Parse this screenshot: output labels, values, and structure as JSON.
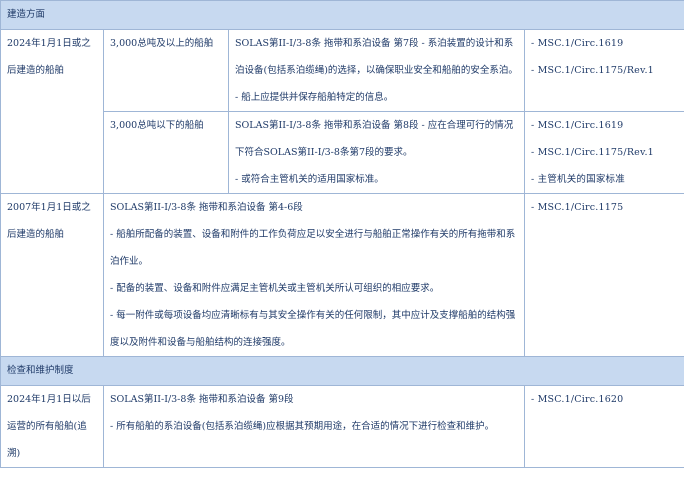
{
  "sections": [
    {
      "title": "建造方面",
      "rows": [
        {
          "scope": "2024年1月1日或之后建造的船舶",
          "sub": [
            {
              "tonnage": "3,000总吨及以上的船舶",
              "req_lines": [
                "SOLAS第II-I/3-8条 拖带和系泊设备 第7段 - 系泊装置的设计和系泊设备(包括系泊缆绳)的选择，以确保职业安全和船舶的安全系泊。",
                "- 船上应提供并保存船舶特定的信息。"
              ],
              "refs": [
                "- MSC.1/Circ.1619",
                "- MSC.1/Circ.1175/Rev.1"
              ]
            },
            {
              "tonnage": "3,000总吨以下的船舶",
              "req_lines": [
                "SOLAS第II-I/3-8条 拖带和系泊设备 第8段 - 应在合理可行的情况下符合SOLAS第II-I/3-8条第7段的要求。",
                "- 或符合主管机关的适用国家标准。"
              ],
              "refs": [
                "- MSC.1/Circ.1619",
                "- MSC.1/Circ.1175/Rev.1",
                "- 主管机关的国家标准"
              ]
            }
          ]
        },
        {
          "scope": "2007年1月1日或之后建造的船舶",
          "req_lines": [
            "SOLAS第II-I/3-8条 拖带和系泊设备 第4-6段",
            "- 船舶所配备的装置、设备和附件的工作负荷应足以安全进行与船舶正常操作有关的所有拖带和系泊作业。",
            "- 配备的装置、设备和附件应满足主管机关或主管机关所认可组织的相应要求。",
            "- 每一附件或每项设备均应清晰标有与其安全操作有关的任何限制，其中应计及支撑船舶的结构强度以及附件和设备与船舶结构的连接强度。"
          ],
          "refs": [
            "- MSC.1/Circ.1175"
          ]
        }
      ]
    },
    {
      "title": "检查和维护制度",
      "rows": [
        {
          "scope": "2024年1月1日以后运营的所有船舶(追溯)",
          "req_lines": [
            "SOLAS第II-I/3-8条 拖带和系泊设备 第9段",
            "- 所有船舶的系泊设备(包括系泊缆绳)应根据其预期用途，在合适的情况下进行检查和维护。"
          ],
          "refs": [
            "- MSC.1/Circ.1620"
          ]
        }
      ]
    }
  ]
}
